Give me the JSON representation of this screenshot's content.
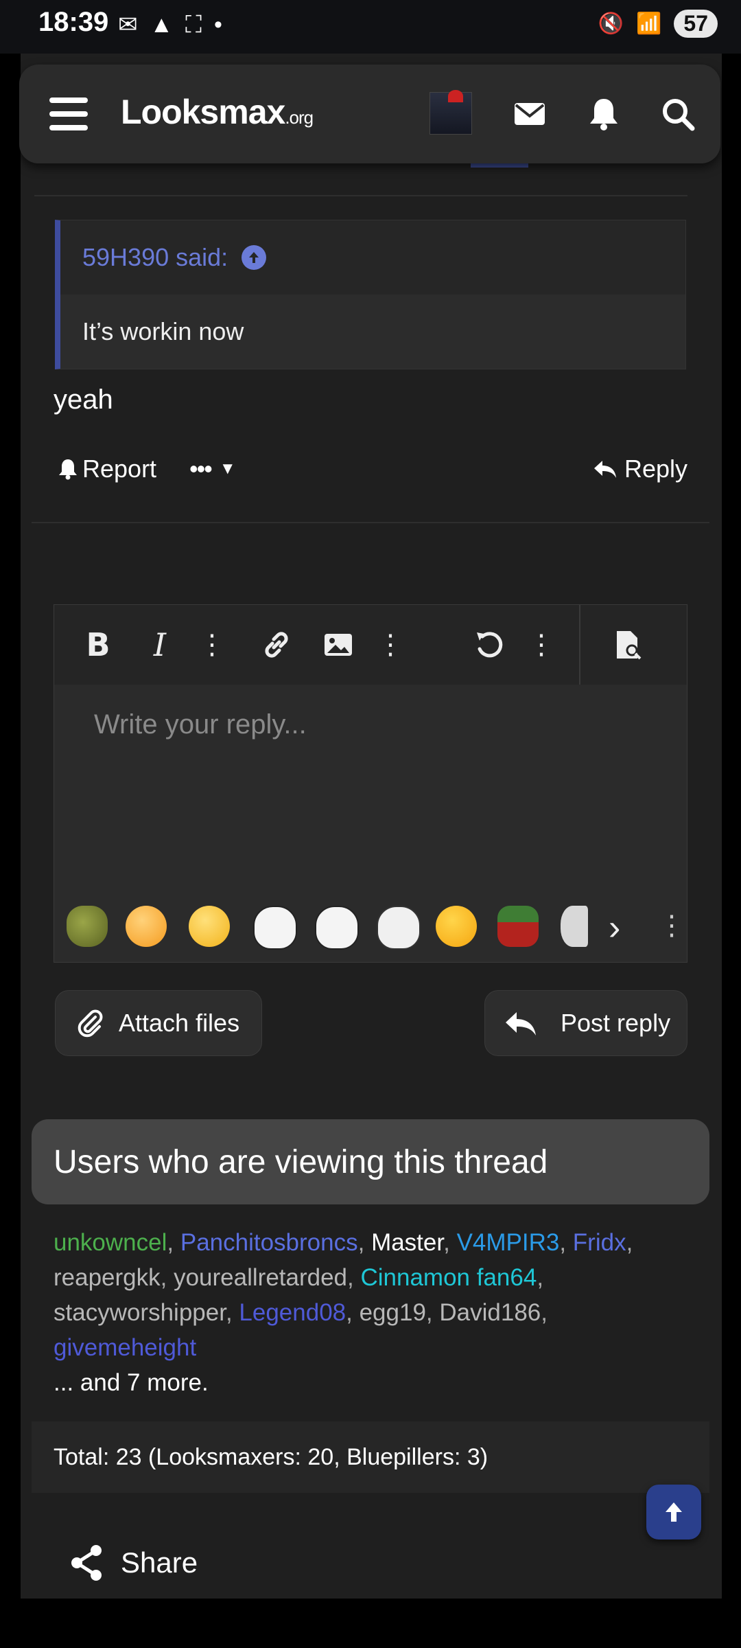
{
  "status_bar": {
    "time": "18:39",
    "battery": "57"
  },
  "header": {
    "logo_main": "Looksmax",
    "logo_suffix": ".org"
  },
  "quote": {
    "author_said": "59H390 said:",
    "text": "It’s workin now"
  },
  "post": {
    "text": "yeah"
  },
  "post_actions": {
    "report": "Report",
    "reply": "Reply"
  },
  "editor": {
    "placeholder": "Write your reply...",
    "toolbar": [
      "bold",
      "italic",
      "more",
      "link",
      "image",
      "more",
      "undo",
      "more",
      "preview"
    ],
    "emoji_bar": [
      "shrek",
      "flushed",
      "crying-laughing",
      "wojak-cry",
      "wojak-glasses",
      "wojak-point",
      "unamused",
      "pepe",
      "wojak-grey"
    ]
  },
  "buttons": {
    "attach": "Attach files",
    "post_reply": "Post reply"
  },
  "viewers": {
    "title": "Users who are viewing this thread",
    "users": [
      {
        "name": "unkowncel",
        "color": "#4db04d"
      },
      {
        "name": "Panchitosbroncs",
        "color": "#5a6fe0"
      },
      {
        "name": "Master",
        "color": "#ffffff"
      },
      {
        "name": "V4MPIR3",
        "color": "#2b9be8"
      },
      {
        "name": "Fridx",
        "color": "#5a6fe0"
      },
      {
        "name": "reapergkk",
        "color": "#b8b8b8"
      },
      {
        "name": "youreallretarded",
        "color": "#b8b8b8"
      },
      {
        "name": "Cinnamon fan64",
        "color": "#1fc7d6"
      },
      {
        "name": "stacyworshipper",
        "color": "#b8b8b8"
      },
      {
        "name": "Legend08",
        "color": "#4f5ad8"
      },
      {
        "name": "egg19",
        "color": "#b8b8b8"
      },
      {
        "name": "David186",
        "color": "#b8b8b8"
      },
      {
        "name": "givemeheight",
        "color": "#4f5ad8"
      }
    ],
    "and_more": "... and 7 more.",
    "total": "Total: 23 (Looksmaxers: 20, Bluepillers: 3)"
  },
  "share": {
    "label": "Share"
  }
}
